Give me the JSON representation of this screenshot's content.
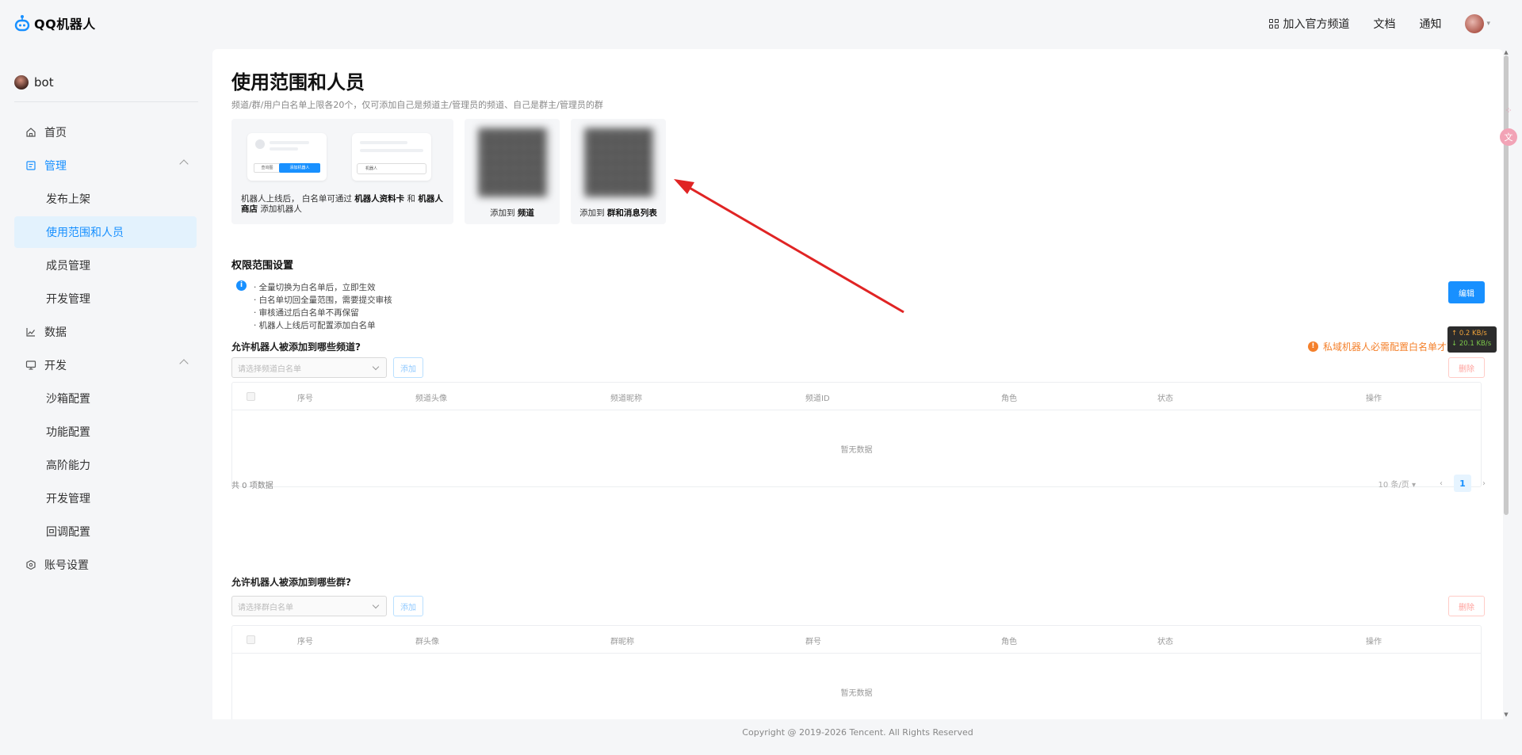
{
  "header": {
    "logo_text": "QQ机器人",
    "join_channel": "加入官方频道",
    "docs": "文档",
    "notify": "通知"
  },
  "sidebar": {
    "bot_name": "bot",
    "items": [
      {
        "label": "首页",
        "icon": "home-icon"
      },
      {
        "label": "管理",
        "icon": "manage-icon"
      },
      {
        "label": "发布上架"
      },
      {
        "label": "使用范围和人员"
      },
      {
        "label": "成员管理"
      },
      {
        "label": "开发管理"
      },
      {
        "label": "数据",
        "icon": "chart-icon"
      },
      {
        "label": "开发",
        "icon": "monitor-icon"
      },
      {
        "label": "沙箱配置"
      },
      {
        "label": "功能配置"
      },
      {
        "label": "高阶能力"
      },
      {
        "label": "开发管理"
      },
      {
        "label": "回调配置"
      },
      {
        "label": "账号设置",
        "icon": "settings-hex-icon"
      }
    ]
  },
  "main": {
    "title": "使用范围和人员",
    "subtitle": "频道/群/用户白名单上限各20个，仅可添加自己是频道主/管理员的频道、自己是群主/管理员的群",
    "card1": {
      "mock_btn_a": "查询图",
      "mock_btn_b": "添加机器人",
      "mock_pill": "机器人",
      "desc_1": "机器人上线后，  白名单可通过 ",
      "desc_bold_1": "机器人资料卡",
      "desc_2": " 和 ",
      "desc_bold_2": "机器人商店",
      "desc_3": " 添加机器人"
    },
    "card2": {
      "cap": "添加到 ",
      "cap_bold": "频道"
    },
    "card3": {
      "cap": "添加到 ",
      "cap_bold": "群和消息列表"
    },
    "perm": {
      "title": "权限范围设置",
      "notes": [
        "· 全量切换为白名单后，立即生效",
        "· 白名单切回全量范围，需要提交审核",
        "· 审核通过后白名单不再保留",
        "· 机器人上线后可配置添加白名单"
      ],
      "edit": "编辑"
    },
    "channel": {
      "question": "允许机器人被添加到哪些频道?",
      "warning": "私域机器人必需配置白名单才可被添加",
      "placeholder": "请选择频道白名单",
      "add": "添加",
      "delete": "删除",
      "columns": [
        "序号",
        "频道头像",
        "频道昵称",
        "频道ID",
        "角色",
        "状态",
        "操作"
      ],
      "empty": "暂无数据",
      "total": "共 0 项数据",
      "page_size": "10 条/页",
      "page": "1"
    },
    "group": {
      "question": "允许机器人被添加到哪些群?",
      "placeholder": "请选择群白名单",
      "add": "添加",
      "delete": "删除",
      "columns": [
        "序号",
        "群头像",
        "群昵称",
        "群号",
        "角色",
        "状态",
        "操作"
      ],
      "empty": "暂无数据"
    }
  },
  "netmon": {
    "up": "↑ 0.2 KB/s",
    "down": "↓ 20.1 KB/s"
  },
  "footer": "Copyright @ 2019-2026 Tencent. All Rights Reserved",
  "colors": {
    "accent": "#1890ff",
    "warning": "#f4802b",
    "arrow": "#e02424"
  }
}
